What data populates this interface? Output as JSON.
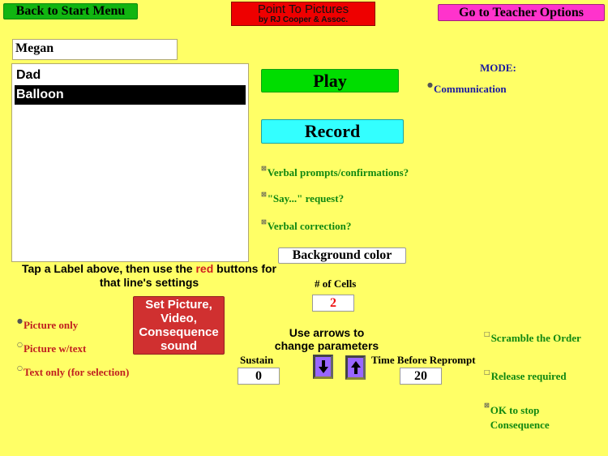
{
  "header": {
    "back_label": "Back to Start Menu",
    "title_line1": "Point To Pictures",
    "title_line2": "by RJ Cooper & Assoc.",
    "teacher_label": "Go to Teacher Options"
  },
  "student_name": "Megan",
  "labels": [
    {
      "text": "Dad",
      "selected": false
    },
    {
      "text": "Balloon",
      "selected": true
    }
  ],
  "buttons": {
    "play": "Play",
    "record": "Record",
    "background_color": "Background color",
    "set_picture": [
      "Set Picture,",
      "Video,",
      "Consequence",
      "sound"
    ]
  },
  "mode": {
    "label": "MODE:",
    "options": [
      {
        "text": "Communication",
        "selected": true
      }
    ]
  },
  "verbal_options": [
    {
      "text": "Verbal prompts/confirmations?",
      "checked": true
    },
    {
      "text": "\"Say...\" request?",
      "checked": true
    },
    {
      "text": "Verbal correction?",
      "checked": true
    }
  ],
  "instructions": {
    "before": "Tap a Label above, then use the ",
    "highlight": "red",
    "after": " buttons for that line's settings"
  },
  "display_options": [
    {
      "text": "Picture only",
      "selected": true
    },
    {
      "text": "Picture w/text",
      "selected": false
    },
    {
      "text": "Text only (for selection)",
      "selected": false
    }
  ],
  "parameters": {
    "cells_label": "# of Cells",
    "cells_value": "2",
    "arrows_hint": "Use arrows to change parameters",
    "sustain_label": "Sustain",
    "sustain_value": "0",
    "reprompt_label": "Time Before Reprompt",
    "reprompt_value": "20"
  },
  "behavior_options": [
    {
      "text": "Scramble the Order",
      "checked": false
    },
    {
      "text": "Release required",
      "checked": false
    },
    {
      "text": "OK to stop Consequence",
      "checked": true
    }
  ],
  "colors": {
    "background": "#ffff66",
    "back_button": "#11b511",
    "teacher_button": "#ff33cc",
    "title_box": "#ee0000",
    "play": "#00dd00",
    "record": "#33ffff",
    "set_picture": "#d03030",
    "arrows": "#9966ff"
  }
}
